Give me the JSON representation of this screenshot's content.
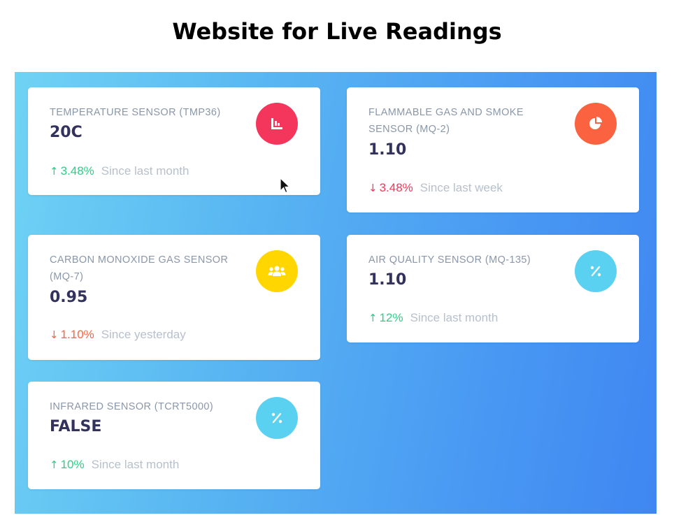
{
  "page": {
    "title": "Website for Live Readings"
  },
  "cards": [
    {
      "label": "TEMPERATURE SENSOR (TMP36)",
      "value": "20C",
      "trend": "3.48%",
      "trend_dir": "up",
      "since": "Since last month",
      "icon": "chart-bar-icon",
      "icon_color": "#f5365c",
      "trend_color": "#2dce89"
    },
    {
      "label": "FLAMMABLE GAS AND SMOKE SENSOR (MQ-2)",
      "value": "1.10",
      "trend": "3.48%",
      "trend_dir": "down",
      "since": "Since last week",
      "icon": "chart-pie-icon",
      "icon_color": "#fb6340",
      "trend_color": "#f5365c"
    },
    {
      "label": "CARBON MONOXIDE GAS SENSOR (MQ-7)",
      "value": "0.95",
      "trend": "1.10%",
      "trend_dir": "down",
      "since": "Since yesterday",
      "icon": "users-icon",
      "icon_color": "#ffd600",
      "trend_color": "#fb6340"
    },
    {
      "label": "AIR QUALITY SENSOR (MQ-135)",
      "value": "1.10",
      "trend": "12%",
      "trend_dir": "up",
      "since": "Since last month",
      "icon": "percent-icon",
      "icon_color": "#5ad1f0",
      "trend_color": "#2dce89"
    },
    {
      "label": "INFRARED SENSOR (TCRT5000)",
      "value": "FALSE",
      "trend": "10%",
      "trend_dir": "up",
      "since": "Since last month",
      "icon": "percent-icon",
      "icon_color": "#5ad1f0",
      "trend_color": "#2dce89"
    }
  ],
  "colors": {
    "gradient_start": "#6fd3f4",
    "gradient_end": "#3f86f2",
    "label": "#8a97a8",
    "value": "#32325d",
    "since": "#b7c0cb"
  }
}
